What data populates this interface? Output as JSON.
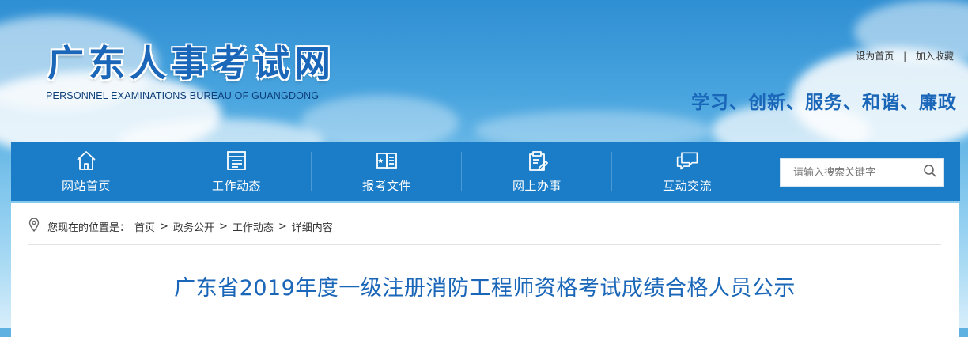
{
  "header": {
    "logo_title": "广东人事考试网",
    "logo_subtitle": "PERSONNEL EXAMINATIONS BUREAU OF GUANGDONG",
    "top_links": [
      "设为首页",
      "加入收藏"
    ],
    "top_links_separator": "|",
    "slogan": "学习、创新、服务、和谐、廉政"
  },
  "nav": {
    "items": [
      {
        "label": "网站首页",
        "icon": "home-icon"
      },
      {
        "label": "工作动态",
        "icon": "news-list-icon"
      },
      {
        "label": "报考文件",
        "icon": "open-book-icon"
      },
      {
        "label": "网上办事",
        "icon": "clipboard-edit-icon"
      },
      {
        "label": "互动交流",
        "icon": "chat-bubbles-icon"
      }
    ],
    "background_color": "#1b7dc7"
  },
  "search": {
    "placeholder": "请输入搜索关键字",
    "icon": "search-icon"
  },
  "breadcrumb": {
    "prefix": "您现在的位置是：",
    "separator": ">",
    "items": [
      "首页",
      "政务公开",
      "工作动态",
      "详细内容"
    ],
    "icon": "location-pin-icon"
  },
  "article": {
    "title": "广东省2019年度一级注册消防工程师资格考试成绩合格人员公示"
  },
  "colors": {
    "brand_blue": "#1a66b8",
    "nav_blue": "#1b7dc7"
  }
}
